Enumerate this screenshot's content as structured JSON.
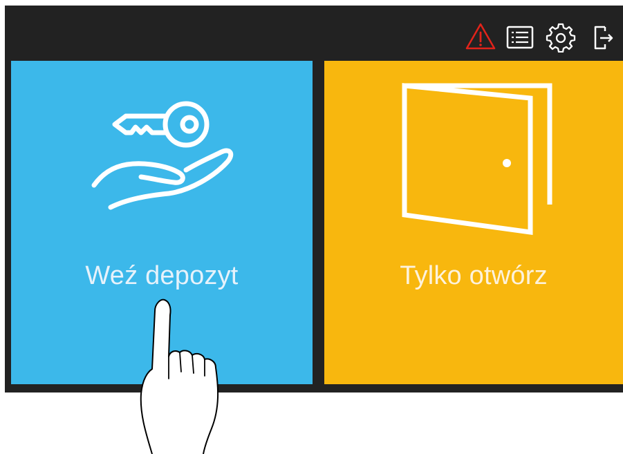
{
  "header": {
    "icons": [
      "warning-icon",
      "list-icon",
      "gear-icon",
      "logout-icon"
    ],
    "warning_color": "#e2231a"
  },
  "tiles": [
    {
      "label": "Weź depozyt",
      "icon": "key-in-hand-icon",
      "color": "#3cb8ea"
    },
    {
      "label": "Tylko otwórz",
      "icon": "door-icon",
      "color": "#f8b70e"
    }
  ],
  "overlay": {
    "icon": "pointing-hand-icon"
  }
}
